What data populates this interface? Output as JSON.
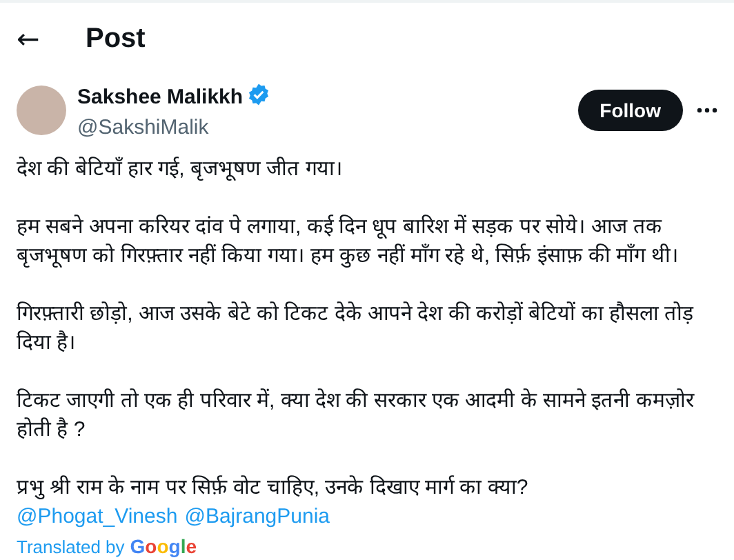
{
  "header": {
    "back_icon": "←",
    "title": "Post"
  },
  "author": {
    "name": "Sakshee Malikkh",
    "verified": true,
    "handle": "@SakshiMalik"
  },
  "follow_button": "Follow",
  "paragraphs": [
    "देश की बेटियाँ हार गई, बृजभूषण जीत गया।",
    "हम सबने अपना करियर दांव पे लगाया, कई दिन धूप बारिश में सड़क पर सोये। आज तक बृजभूषण को गिरफ़्तार नहीं किया गया। हम कुछ नहीं माँग रहे थे, सिर्फ़ इंसाफ़ की माँग थी।",
    "गिरफ़्तारी छोड़ो, आज उसके बेटे को टिकट देके आपने देश की करोड़ों बेटियों का हौसला तोड़ दिया है।",
    "टिकट जाएगी तो एक ही परिवार में, क्या देश की सरकार एक आदमी के सामने इतनी कमज़ोर होती है ?",
    "प्रभु श्री राम के नाम पर सिर्फ़ वोट चाहिए, उनके दिखाए मार्ग का क्या?"
  ],
  "mentions": [
    "@Phogat_Vinesh",
    "@BajrangPunia"
  ],
  "translation": {
    "label": "Translated by",
    "logo": "Google"
  }
}
